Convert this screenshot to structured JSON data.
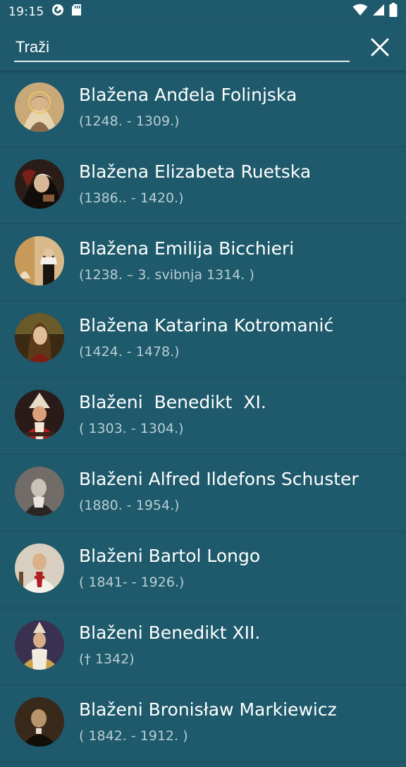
{
  "status_bar": {
    "time": "19:15",
    "icons": [
      "sync-icon",
      "sd-card-icon",
      "wifi-icon",
      "signal-icon",
      "battery-icon"
    ]
  },
  "search": {
    "placeholder": "Traži",
    "value": ""
  },
  "colors": {
    "background": "#1e5a6b",
    "divider": "#184d5c",
    "secondary_text": "#b9cdd3"
  },
  "items": [
    {
      "name": "Blažena Anđela Folinjska",
      "dates": "(1248. - 1309.)"
    },
    {
      "name": "Blažena Elizabeta Ruetska",
      "dates": "(1386.. - 1420.)"
    },
    {
      "name": "Blažena Emilija Bicchieri",
      "dates": "(1238. – 3. svibnja 1314. )"
    },
    {
      "name": "Blažena Katarina Kotromanić",
      "dates": "(1424. - 1478.)"
    },
    {
      "name": "Blaženi  Benedikt  XI.",
      "dates": "( 1303. - 1304.)"
    },
    {
      "name": "Blaženi Alfred Ildefons Schuster",
      "dates": "(1880. - 1954.)"
    },
    {
      "name": "Blaženi Bartol Longo",
      "dates": "( 1841- - 1926.)"
    },
    {
      "name": "Blaženi Benedikt XII.",
      "dates": "(† 1342)"
    },
    {
      "name": "Blaženi Bronisław Markiewicz",
      "dates": "( 1842. - 1912. )"
    }
  ]
}
